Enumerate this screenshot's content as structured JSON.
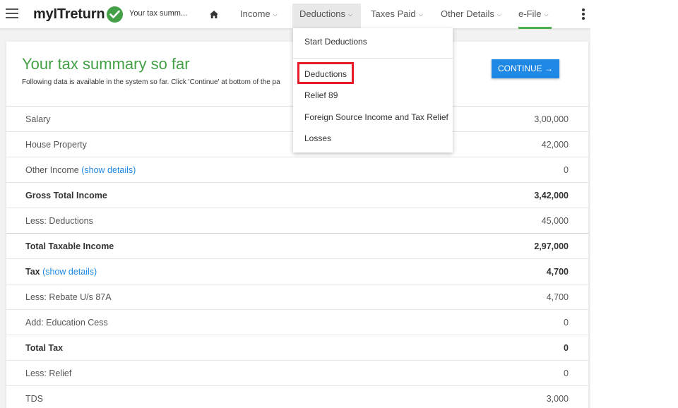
{
  "header": {
    "logo_text": "myITreturn",
    "breadcrumb": "Your tax summ...",
    "nav": [
      {
        "label": "Income"
      },
      {
        "label": "Deductions"
      },
      {
        "label": "Taxes Paid"
      },
      {
        "label": "Other Details"
      },
      {
        "label": "e-File"
      }
    ],
    "accent_color": "#4caf50"
  },
  "card": {
    "title": "Your tax summary so far",
    "subtitle": "Following data is available in the system so far. Click 'Continue' at bottom of the pa",
    "continue_label": "CONTINUE"
  },
  "summary": {
    "rows": [
      {
        "label": "Salary",
        "value": "3,00,000"
      },
      {
        "label": "House Property",
        "value": "42,000"
      },
      {
        "label": "Other Income",
        "link": "(show details)",
        "value": "0"
      },
      {
        "label": "Gross Total Income",
        "value": "3,42,000"
      },
      {
        "label": "Less: Deductions",
        "value": "45,000"
      },
      {
        "label": "Total Taxable Income",
        "value": "2,97,000"
      },
      {
        "label": "Tax",
        "link": "(show details)",
        "value": "4,700"
      },
      {
        "label": "Less: Rebate U/s 87A",
        "value": "4,700"
      },
      {
        "label": "Add: Education Cess",
        "value": "0"
      },
      {
        "label": "Total Tax",
        "value": "0"
      },
      {
        "label": "Less: Relief",
        "value": "0"
      },
      {
        "label": "TDS",
        "value": "3,000"
      }
    ]
  },
  "dropdown": {
    "items": [
      {
        "label": "Start Deductions"
      },
      {
        "label": "Deductions"
      },
      {
        "label": "Relief 89"
      },
      {
        "label": "Foreign Source Income and Tax Relief"
      },
      {
        "label": "Losses"
      }
    ],
    "highlight_color": "#e51c23"
  }
}
